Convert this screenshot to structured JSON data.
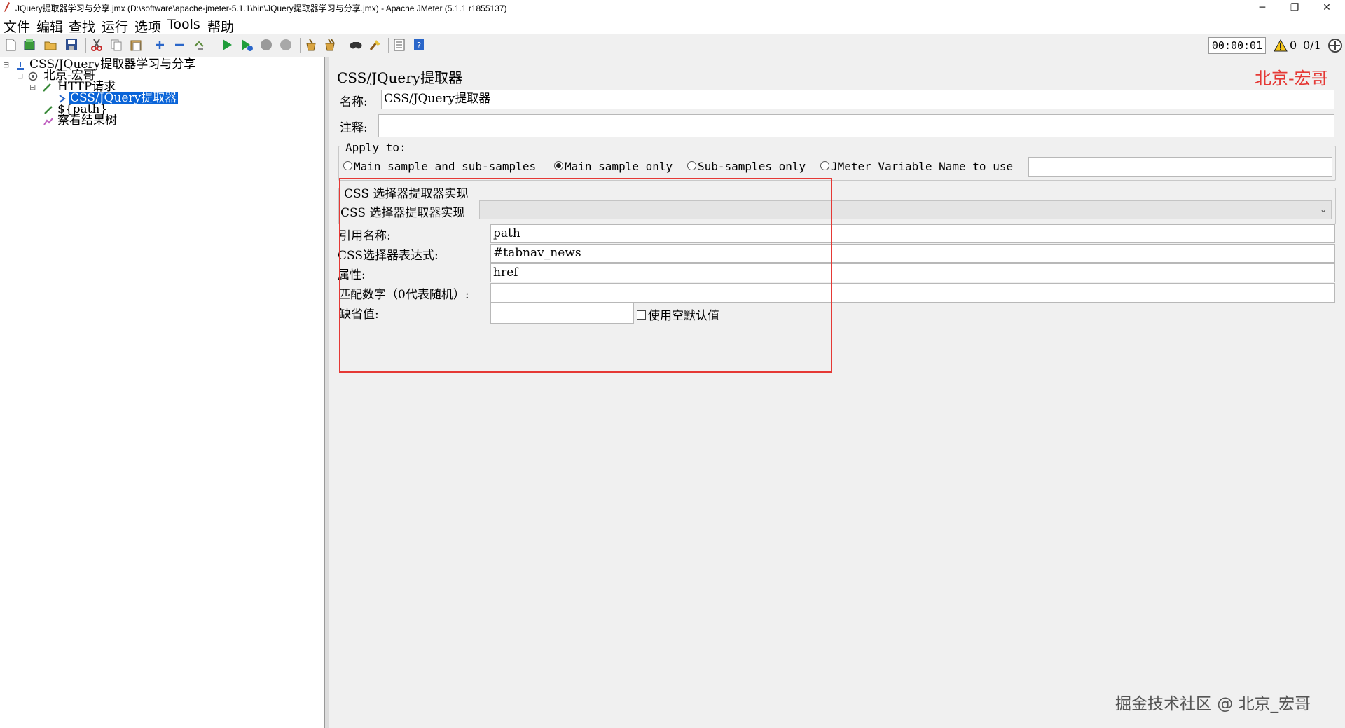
{
  "window": {
    "title": "JQuery提取器学习与分享.jmx (D:\\software\\apache-jmeter-5.1.1\\bin\\JQuery提取器学习与分享.jmx) - Apache JMeter (5.1.1 r1855137)",
    "minimize": "─",
    "restore": "❐",
    "close": "✕"
  },
  "menu": [
    "文件",
    "编辑",
    "查找",
    "运行",
    "选项",
    "Tools",
    "帮助"
  ],
  "toolbar": {
    "timer": "00:00:01",
    "error_count": "0",
    "threads": "0/1"
  },
  "tree": {
    "root": "CSS/JQuery提取器学习与分享",
    "thread_group": "北京-宏哥",
    "http_request": "HTTP请求",
    "extractor": "CSS/JQuery提取器",
    "debug": "${path}",
    "listener": "察看结果树"
  },
  "panel": {
    "title": "CSS/JQuery提取器",
    "brand": "北京-宏哥",
    "name_label": "名称:",
    "name_value": "CSS/JQuery提取器",
    "comment_label": "注释:",
    "comment_value": "",
    "apply_to_label": "Apply to:",
    "apply_options": [
      "Main sample and sub-samples",
      "Main sample only",
      "Sub-samples only",
      "JMeter Variable Name to use"
    ],
    "apply_selected": "Main sample only",
    "var_name_value": "",
    "impl_section": "CSS 选择器提取器实现",
    "impl_label": "CSS 选择器提取器实现",
    "impl_value": "",
    "ref_name_label": "引用名称:",
    "ref_name_value": "path",
    "css_expr_label": "CSS选择器表达式:",
    "css_expr_value": "#tabnav_news",
    "attr_label": "属性:",
    "attr_value": "href",
    "match_label": "匹配数字（0代表随机）:",
    "match_value": "",
    "default_label": "缺省值:",
    "default_value": "",
    "use_empty_label": "使用空默认值"
  },
  "watermark": "掘金技术社区 @ 北京_宏哥",
  "colors": {
    "accent_red": "#e53935",
    "selection": "#0a64d8"
  }
}
